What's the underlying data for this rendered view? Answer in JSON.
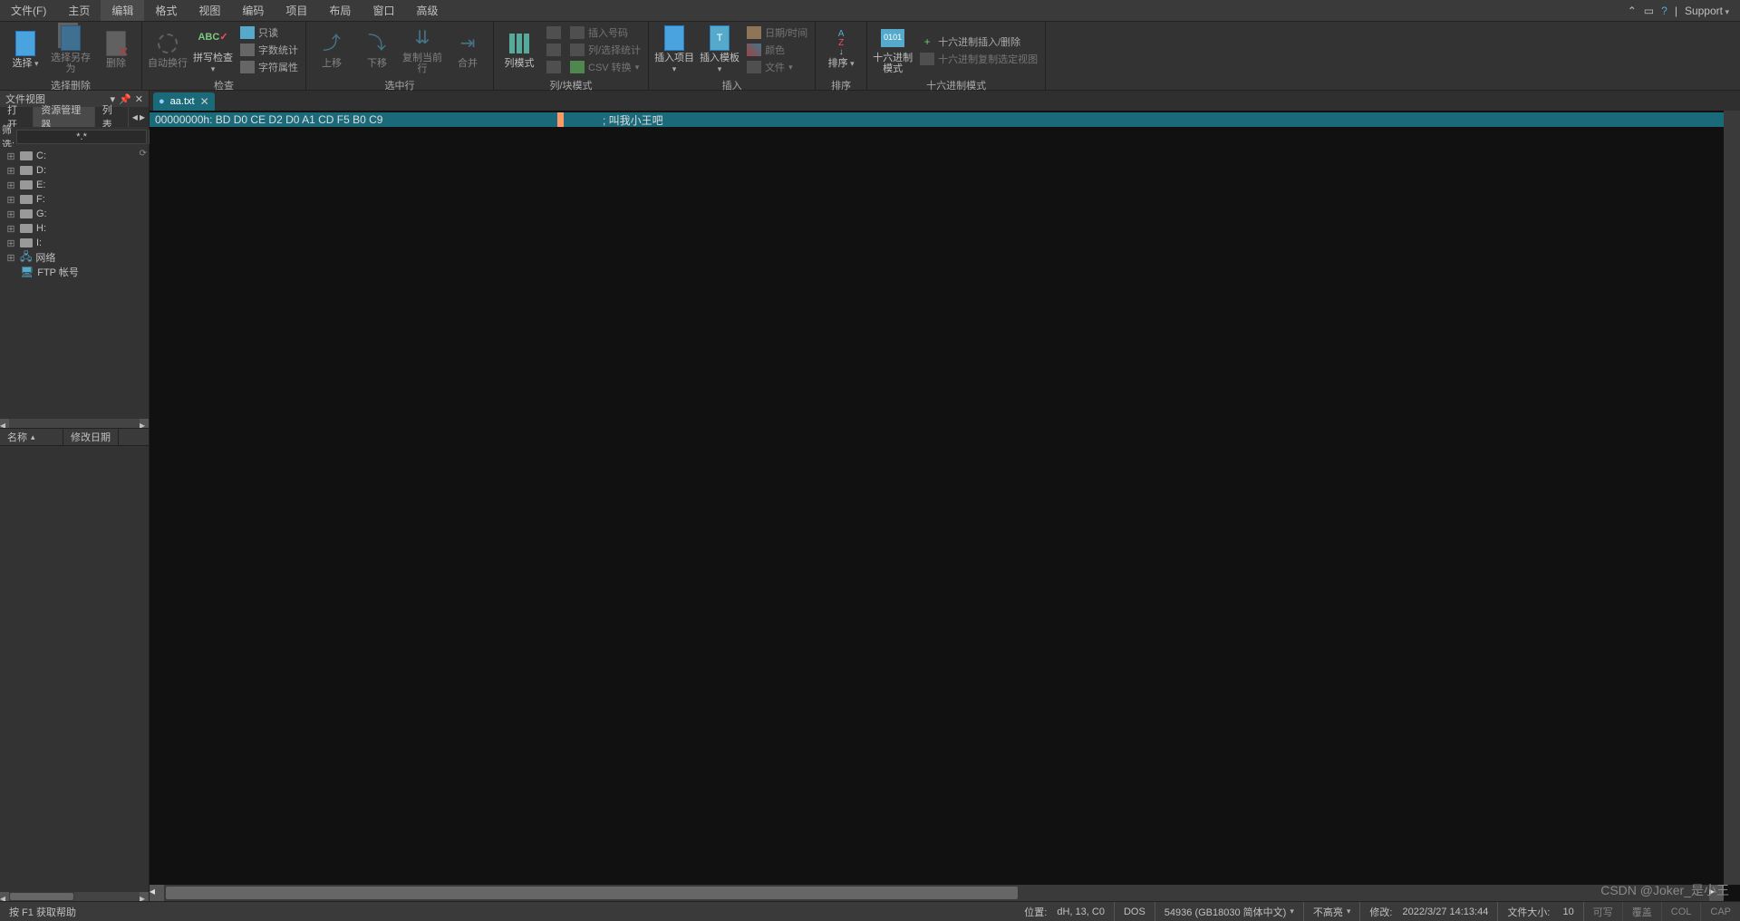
{
  "menu": {
    "items": [
      "文件(F)",
      "主页",
      "编辑",
      "格式",
      "视图",
      "编码",
      "项目",
      "布局",
      "窗口",
      "高级"
    ],
    "active_index": 2,
    "support": "Support"
  },
  "ribbon": {
    "groups": [
      {
        "label": "选择删除",
        "buttons": [
          {
            "label": "选择",
            "dd": true,
            "icon": "doc"
          },
          {
            "label": "选择另存为",
            "icon": "doc2",
            "disabled": true
          },
          {
            "label": "删除",
            "icon": "doc3",
            "disabled": true
          }
        ]
      },
      {
        "label": "检查",
        "buttons": [
          {
            "label": "自动换行",
            "icon": "gear",
            "disabled": true
          },
          {
            "label": "拼写检查",
            "dd": true,
            "icon": "abc"
          }
        ],
        "small": [
          "只读",
          "字数统计",
          "字符属性"
        ]
      },
      {
        "label": "选中行",
        "buttons": [
          {
            "label": "上移",
            "icon": "arr-up",
            "disabled": true
          },
          {
            "label": "下移",
            "icon": "arr-down",
            "disabled": true
          },
          {
            "label": "复制当前行",
            "icon": "arr-dup",
            "disabled": true
          },
          {
            "label": "合并",
            "icon": "arr-join",
            "disabled": true
          }
        ]
      },
      {
        "label": "列/块模式",
        "buttons": [
          {
            "label": "列模式",
            "icon": "cols"
          }
        ],
        "small_cols": [
          [
            "插入号码",
            "列/选择统计",
            "CSV 转换"
          ]
        ]
      },
      {
        "label": "插入",
        "buttons": [
          {
            "label": "插入项目",
            "dd": true,
            "icon": "doc"
          },
          {
            "label": "插入模板",
            "dd": true,
            "icon": "tmpl"
          }
        ],
        "small": [
          "日期/时间",
          "颜色",
          "文件"
        ]
      },
      {
        "label": "排序",
        "buttons": [
          {
            "label": "排序",
            "dd": true,
            "icon": "sort"
          }
        ]
      },
      {
        "label": "十六进制模式",
        "buttons": [
          {
            "label": "十六进制模式",
            "icon": "hex"
          }
        ],
        "small": [
          "十六进制插入/删除",
          "十六进制复制选定视图"
        ]
      }
    ]
  },
  "sidebar": {
    "panel_title": "文件视图",
    "tabs": [
      "打开",
      "资源管理器",
      "列表"
    ],
    "active_tab": 1,
    "filter_label": "筛选:",
    "filter_value": "*.*",
    "tree": [
      {
        "label": "C:",
        "icon": "drive",
        "exp": true
      },
      {
        "label": "D:",
        "icon": "drive",
        "exp": true
      },
      {
        "label": "E:",
        "icon": "drive",
        "exp": true
      },
      {
        "label": "F:",
        "icon": "drive",
        "exp": true
      },
      {
        "label": "G:",
        "icon": "drive",
        "exp": true
      },
      {
        "label": "H:",
        "icon": "drive",
        "exp": true
      },
      {
        "label": "I:",
        "icon": "drive",
        "exp": true
      },
      {
        "label": "网络",
        "icon": "net",
        "exp": true
      },
      {
        "label": "FTP 帐号",
        "icon": "ftp",
        "exp": false
      }
    ],
    "columns": [
      "名称",
      "修改日期"
    ]
  },
  "editor": {
    "tab": {
      "modifier": "●",
      "name": "aa.txt"
    },
    "hex_line": {
      "addr": "00000000h:",
      "bytes": " BD D0 CE D2 D0 A1 CD F5 B0 C9",
      "ascii": "; 叫我小王吧"
    }
  },
  "statusbar": {
    "help": "按 F1 获取帮助",
    "pos_label": "位置:",
    "pos": "dH, 13, C0",
    "eol": "DOS",
    "enc": "54936 (GB18030 简体中文)",
    "highlight": "不高亮",
    "mod_label": "修改:",
    "mod": "2022/3/27 14:13:44",
    "size_label": "文件大小:",
    "size": "10",
    "ind1": "可写",
    "ind2": "覆盖",
    "ind3": "COL",
    "ind4": "CAP"
  },
  "watermark": "CSDN @Joker_是小王"
}
